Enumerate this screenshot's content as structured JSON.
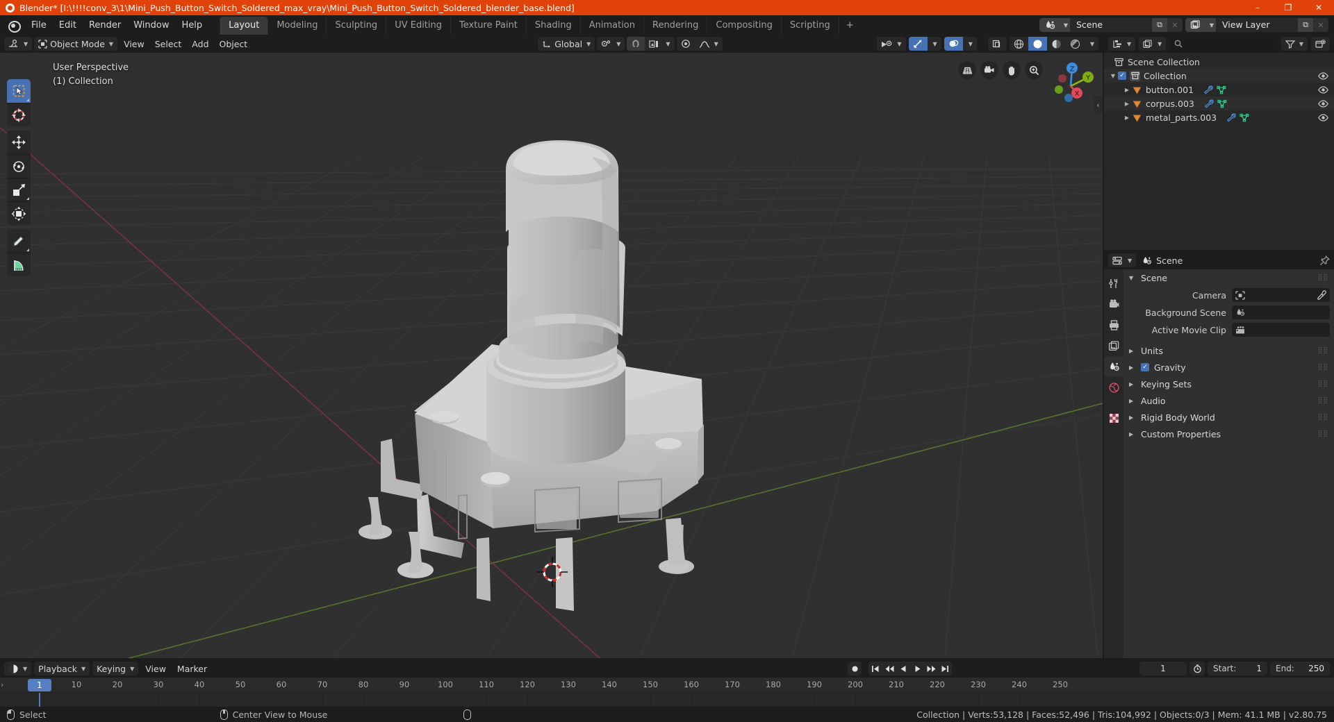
{
  "window": {
    "title": "Blender* [I:\\!!!!conv_3\\1\\Mini_Push_Button_Switch_Soldered_max_vray\\Mini_Push_Button_Switch_Soldered_blender_base.blend]",
    "minimize": "–",
    "maximize": "❐",
    "close": "✕",
    "accent": "#e0420a"
  },
  "topbar": {
    "menus": [
      "File",
      "Edit",
      "Render",
      "Window",
      "Help"
    ],
    "workspaces": [
      {
        "label": "Layout",
        "active": true
      },
      {
        "label": "Modeling",
        "active": false
      },
      {
        "label": "Sculpting",
        "active": false
      },
      {
        "label": "UV Editing",
        "active": false
      },
      {
        "label": "Texture Paint",
        "active": false
      },
      {
        "label": "Shading",
        "active": false
      },
      {
        "label": "Animation",
        "active": false
      },
      {
        "label": "Rendering",
        "active": false
      },
      {
        "label": "Compositing",
        "active": false
      },
      {
        "label": "Scripting",
        "active": false
      }
    ],
    "add_workspace": "+",
    "scene": {
      "name": "Scene",
      "new_label": "⧉",
      "unlink_label": "✕"
    },
    "view_layer": {
      "name": "View Layer",
      "new_label": "⧉",
      "unlink_label": "✕"
    }
  },
  "viewport": {
    "mode": "Object Mode",
    "menus": [
      "View",
      "Select",
      "Add",
      "Object"
    ],
    "transform_orientation": "Global",
    "overlay_text_line1": "User Perspective",
    "overlay_text_line2": "(1) Collection",
    "gizmo_axes": [
      {
        "label": "Z",
        "color": "#3c8ce0"
      },
      {
        "label": "Y",
        "color": "#8fbe00"
      },
      {
        "label": "X",
        "color": "#e04a5a"
      }
    ],
    "nav_icons": [
      "grid-ortho-icon",
      "camera-view-icon",
      "hand-pan-icon",
      "zoom-icon"
    ],
    "tools": [
      {
        "name": "tweak-select-tool",
        "active": true
      },
      {
        "name": "cursor-tool",
        "active": false
      },
      {
        "name": "move-tool",
        "active": false
      },
      {
        "name": "rotate-tool",
        "active": false
      },
      {
        "name": "scale-tool",
        "active": false
      },
      {
        "name": "transform-tool",
        "active": false
      },
      {
        "name": "annotate-tool",
        "active": false
      },
      {
        "name": "measure-tool",
        "active": false
      }
    ],
    "shading_modes": [
      "wireframe",
      "solid",
      "material-preview",
      "rendered"
    ],
    "active_shading": "solid"
  },
  "outliner": {
    "display_mode": "view-layer-icon",
    "filter_icon": "filter-icon",
    "new_collection_icon": "new-collection-icon",
    "search_placeholder": "",
    "rows": [
      {
        "indent": 0,
        "tri": "",
        "icon": "scene-collection-icon",
        "label": "Scene Collection",
        "checkbox": false,
        "eye": false,
        "alt": false,
        "modifiers": []
      },
      {
        "indent": 1,
        "tri": "▼",
        "icon": "collection-icon",
        "label": "Collection",
        "checkbox": true,
        "eye": true,
        "alt": true,
        "modifiers": []
      },
      {
        "indent": 2,
        "tri": "▶",
        "icon": "mesh-object-icon",
        "label": "button.001",
        "checkbox": false,
        "eye": true,
        "alt": false,
        "modifiers": [
          "wrench-icon",
          "mesh-data-icon"
        ]
      },
      {
        "indent": 2,
        "tri": "▶",
        "icon": "mesh-object-icon",
        "label": "corpus.003",
        "checkbox": false,
        "eye": true,
        "alt": true,
        "modifiers": [
          "wrench-icon",
          "mesh-data-icon"
        ]
      },
      {
        "indent": 2,
        "tri": "▶",
        "icon": "mesh-object-icon",
        "label": "metal_parts.003",
        "checkbox": false,
        "eye": true,
        "alt": false,
        "modifiers": [
          "wrench-icon",
          "mesh-data-icon"
        ]
      }
    ]
  },
  "properties": {
    "breadcrumb_icon": "scene-icon",
    "breadcrumb": "Scene",
    "pin_icon": "pin-icon",
    "tabs": [
      {
        "name": "tool-tab",
        "active": false
      },
      {
        "name": "render-tab",
        "active": false
      },
      {
        "name": "output-tab",
        "active": false
      },
      {
        "name": "view-layer-tab",
        "active": false
      },
      {
        "name": "scene-tab",
        "active": true
      },
      {
        "name": "world-tab",
        "active": false
      },
      {
        "name": "texture-tab",
        "active": false
      }
    ],
    "panels": [
      {
        "label": "Scene",
        "open": true,
        "checkbox": null
      },
      {
        "label": "Units",
        "open": false,
        "checkbox": null
      },
      {
        "label": "Gravity",
        "open": false,
        "checkbox": true
      },
      {
        "label": "Keying Sets",
        "open": false,
        "checkbox": null
      },
      {
        "label": "Audio",
        "open": false,
        "checkbox": null
      },
      {
        "label": "Rigid Body World",
        "open": false,
        "checkbox": null
      },
      {
        "label": "Custom Properties",
        "open": false,
        "checkbox": null
      }
    ],
    "fields": [
      {
        "label": "Camera",
        "value": "",
        "icon": "camera-data-icon",
        "eyedropper": true
      },
      {
        "label": "Background Scene",
        "value": "",
        "icon": "scene-icon",
        "eyedropper": false
      },
      {
        "label": "Active Movie Clip",
        "value": "",
        "icon": "clip-icon",
        "eyedropper": false
      }
    ]
  },
  "timeline": {
    "editor_icon": "timeline-editor-icon",
    "menus": [
      "Playback",
      "Keying",
      "View",
      "Marker"
    ],
    "record_icon": "record-icon",
    "transport": [
      "jump-start-icon",
      "prev-keyframe-icon",
      "play-reverse-icon",
      "play-icon",
      "next-keyframe-icon",
      "jump-end-icon"
    ],
    "current_frame": "1",
    "auto_key_icon": "auto-key-icon",
    "start_label": "Start:",
    "start_value": "1",
    "end_label": "End:",
    "end_value": "250",
    "ticks": [
      1,
      10,
      20,
      30,
      40,
      50,
      60,
      70,
      80,
      90,
      100,
      110,
      120,
      130,
      140,
      150,
      160,
      170,
      180,
      190,
      200,
      210,
      220,
      230,
      240,
      250
    ]
  },
  "statusbar": {
    "left": [
      {
        "mouse": "left",
        "label": "Select"
      },
      {
        "mouse": "middle",
        "label": "Center View to Mouse"
      },
      {
        "mouse": "right",
        "label": ""
      }
    ],
    "stats": "Collection | Verts:53,128 | Faces:52,496 | Tris:104,992 | Objects:0/3 | Mem: 41.1 MB | v2.80.75"
  }
}
